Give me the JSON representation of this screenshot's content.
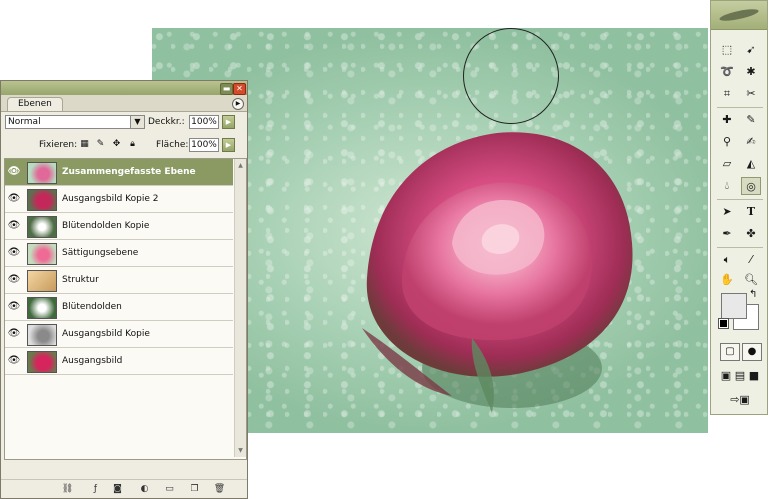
{
  "layers_panel": {
    "tab_label": "Ebenen",
    "blend_mode": "Normal",
    "opacity_label": "Deckkr.:",
    "opacity_value": "100%",
    "lock_label": "Fixieren:",
    "fill_label": "Fläche:",
    "fill_value": "100%",
    "layers": [
      {
        "name": "Zusammengefasste Ebene",
        "selected": true
      },
      {
        "name": "Ausgangsbild Kopie 2",
        "selected": false
      },
      {
        "name": "Blütendolden Kopie",
        "selected": false
      },
      {
        "name": "Sättigungsebene",
        "selected": false
      },
      {
        "name": "Struktur",
        "selected": false
      },
      {
        "name": "Blütendolden",
        "selected": false
      },
      {
        "name": "Ausgangsbild Kopie",
        "selected": false
      },
      {
        "name": "Ausgangsbild",
        "selected": false
      }
    ]
  },
  "toolbar": {
    "type_tool_glyph": "T"
  },
  "colors": {
    "selected_layer": "#8b9a63",
    "panel_title": "#a3af78",
    "close_button": "#d44a2a"
  }
}
